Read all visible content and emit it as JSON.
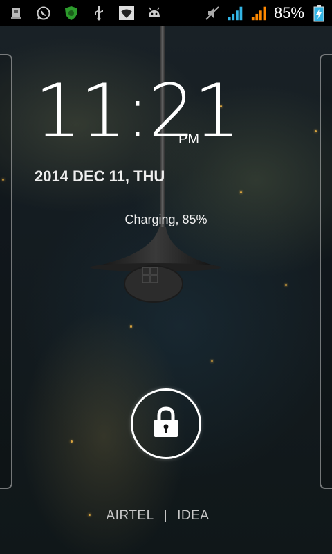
{
  "status_bar": {
    "left_icons": [
      "sim-card-icon",
      "whatsapp-icon",
      "antivirus-shield-icon",
      "usb-icon",
      "wifi-icon",
      "android-debug-icon"
    ],
    "right_icons": [
      "vibrate-mute-icon",
      "signal-sim1-icon",
      "signal-sim2-icon",
      "battery-charging-icon"
    ],
    "battery_percent_text": "85%",
    "colors": {
      "sim1_signal": "#33b5e5",
      "sim2_signal": "#ff8800",
      "battery": "#33b5e5"
    }
  },
  "lockscreen": {
    "time": "11:21",
    "ampm": "PM",
    "date": "2014 DEC 11, THU",
    "charging_status": "Charging, 85%",
    "lock_icon": "lock-icon",
    "carriers": [
      "AIRTEL",
      "IDEA"
    ],
    "carrier_separator": "|"
  }
}
